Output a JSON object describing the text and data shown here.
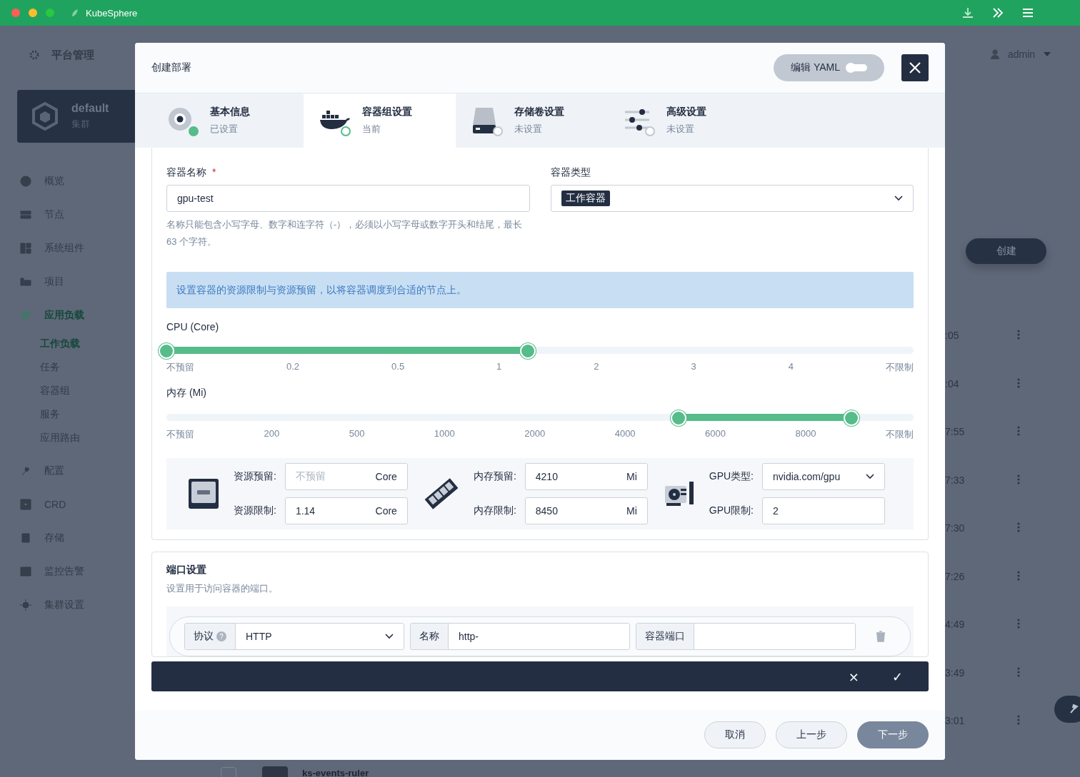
{
  "window": {
    "title": "KubeSphere"
  },
  "sidebar": {
    "header": "平台管理",
    "cluster": {
      "name": "default",
      "subtitle": "集群"
    },
    "items": [
      {
        "label": "概览",
        "selected": false
      },
      {
        "label": "节点",
        "selected": false
      },
      {
        "label": "系统组件",
        "selected": false
      },
      {
        "label": "项目",
        "selected": false
      },
      {
        "label": "应用负载",
        "selected": true,
        "children": [
          {
            "label": "工作负载",
            "selected": true
          },
          {
            "label": "任务",
            "selected": false
          },
          {
            "label": "容器组",
            "selected": false
          },
          {
            "label": "服务",
            "selected": false
          },
          {
            "label": "应用路由",
            "selected": false
          }
        ]
      },
      {
        "label": "配置",
        "selected": false
      },
      {
        "label": "CRD",
        "selected": false
      },
      {
        "label": "存储",
        "selected": false
      },
      {
        "label": "监控告警",
        "selected": false
      },
      {
        "label": "集群设置",
        "selected": false
      }
    ]
  },
  "topbar": {
    "user": "admin"
  },
  "create_button": "创建",
  "rows": [
    {
      "time": ":05"
    },
    {
      "time": ":04"
    },
    {
      "time": "7:55"
    },
    {
      "time": "7:33"
    },
    {
      "time": "7:30"
    },
    {
      "time": "7:26"
    },
    {
      "time": "4:49"
    },
    {
      "time": "3:49"
    },
    {
      "time": "3:01"
    }
  ],
  "bottom_row": {
    "checked": false,
    "name": "ks-events-ruler"
  },
  "dialog": {
    "title": "创建部署",
    "yaml_toggle": {
      "label": "编辑 YAML",
      "on": false
    },
    "steps": [
      {
        "title": "基本信息",
        "status": "已设置",
        "done": true,
        "selected": false
      },
      {
        "title": "容器组设置",
        "status": "当前",
        "done": false,
        "selected": true
      },
      {
        "title": "存储卷设置",
        "status": "未设置",
        "done": false,
        "selected": false
      },
      {
        "title": "高级设置",
        "status": "未设置",
        "done": false,
        "selected": false
      }
    ],
    "container": {
      "name_label": "容器名称",
      "required_mark": "*",
      "name_value": "gpu-test",
      "name_hint": "名称只能包含小写字母、数字和连字符（-），必须以小写字母或数字开头和结尾，最长 63 个字符。",
      "type_label": "容器类型",
      "type_value": "工作容器"
    },
    "notice": "设置容器的资源限制与资源预留，以将容器调度到合适的节点上。",
    "sliders": [
      {
        "label": "CPU (Core)",
        "low": {
          "level": 0
        },
        "high": {
          "level": 0.484
        },
        "ticks": [
          "不预留",
          "0.2",
          "0.5",
          "1",
          "2",
          "3",
          "4",
          "不限制"
        ]
      },
      {
        "label": "内存 (Mi)",
        "low": {
          "level": 0.685
        },
        "high": {
          "level": 0.917
        },
        "ticks": [
          "不预留",
          "200",
          "500",
          "1000",
          "2000",
          "4000",
          "6000",
          "8000",
          "不限制"
        ]
      }
    ],
    "resources": [
      {
        "kind": "cpu",
        "fields": [
          {
            "label": "资源预留:",
            "placeholder": "不预留",
            "unit": "Core"
          },
          {
            "label": "资源限制:",
            "value": "1.14",
            "unit": "Core"
          }
        ]
      },
      {
        "kind": "memory",
        "fields": [
          {
            "label": "内存预留:",
            "value": "4210",
            "unit": "Mi"
          },
          {
            "label": "内存限制:",
            "value": "8450",
            "unit": "Mi"
          }
        ]
      },
      {
        "kind": "gpu",
        "fields": [
          {
            "label": "GPU类型:",
            "value": "nvidia.com/gpu",
            "kind": "select"
          },
          {
            "label": "GPU限制:",
            "value": "2"
          }
        ]
      }
    ],
    "ports": {
      "title": "端口设置",
      "description": "设置用于访问容器的端口。",
      "protocol_label": "协议",
      "help": "?",
      "protocol": "HTTP",
      "name_label": "名称",
      "name_value": "http-",
      "port_label": "容器端口"
    },
    "edit_bar": {
      "cancel": "×",
      "confirm": "✓"
    },
    "buttons": [
      {
        "label": "取消",
        "primary": false
      },
      {
        "label": "上一步",
        "primary": false
      },
      {
        "label": "下一步",
        "primary": true
      }
    ]
  }
}
